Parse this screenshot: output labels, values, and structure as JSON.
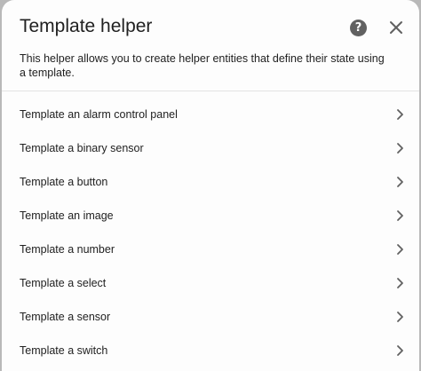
{
  "dialog": {
    "title": "Template helper",
    "description": "This helper allows you to create helper entities that define their state using a template.",
    "help_icon": "help-circle-icon",
    "close_icon": "close-icon",
    "items": [
      {
        "label": "Template an alarm control panel"
      },
      {
        "label": "Template a binary sensor"
      },
      {
        "label": "Template a button"
      },
      {
        "label": "Template an image"
      },
      {
        "label": "Template a number"
      },
      {
        "label": "Template a select"
      },
      {
        "label": "Template a sensor"
      },
      {
        "label": "Template a switch"
      }
    ]
  },
  "colors": {
    "background": "#fdfdfd",
    "overlay": "#b9b9b9",
    "text": "#212121",
    "icon": "#616161",
    "divider": "#e3e3e3"
  }
}
